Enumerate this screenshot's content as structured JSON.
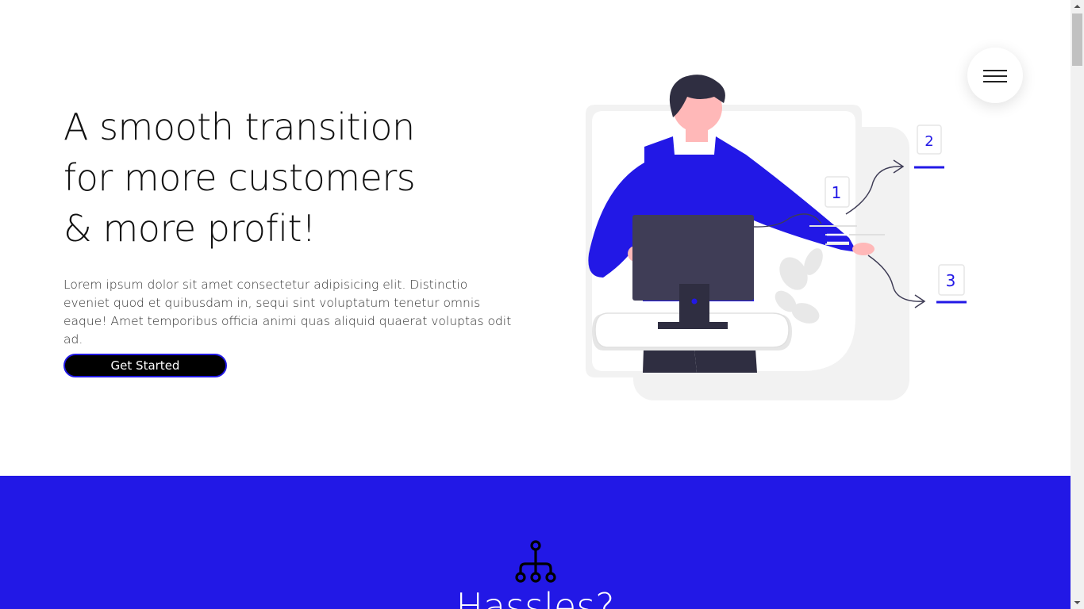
{
  "hero": {
    "title_lines": [
      "A smooth transition",
      "for more customers",
      "& more profit!"
    ],
    "description": "Lorem ipsum dolor sit amet consectetur adipisicing elit. Distinctio eveniet quod et quibusdam in, sequi sint voluptatum tenetur omnis eaque! Amet temporibus officia animi quas aliquid quaerat voluptas odit ad.",
    "cta_label": "Get Started"
  },
  "menu": {
    "icon": "hamburger-menu-icon"
  },
  "illustration": {
    "icon": "person-presenting-illustration",
    "step_labels": [
      "1",
      "2",
      "3"
    ]
  },
  "features": {
    "icon": "hierarchy-icon",
    "title": "Hassles?"
  },
  "colors": {
    "accent": "#2218e6",
    "button_bg": "#000000",
    "illustration_gray": "#f2f2f2",
    "monitor": "#3f3d56",
    "skin": "#ffb8b8"
  }
}
